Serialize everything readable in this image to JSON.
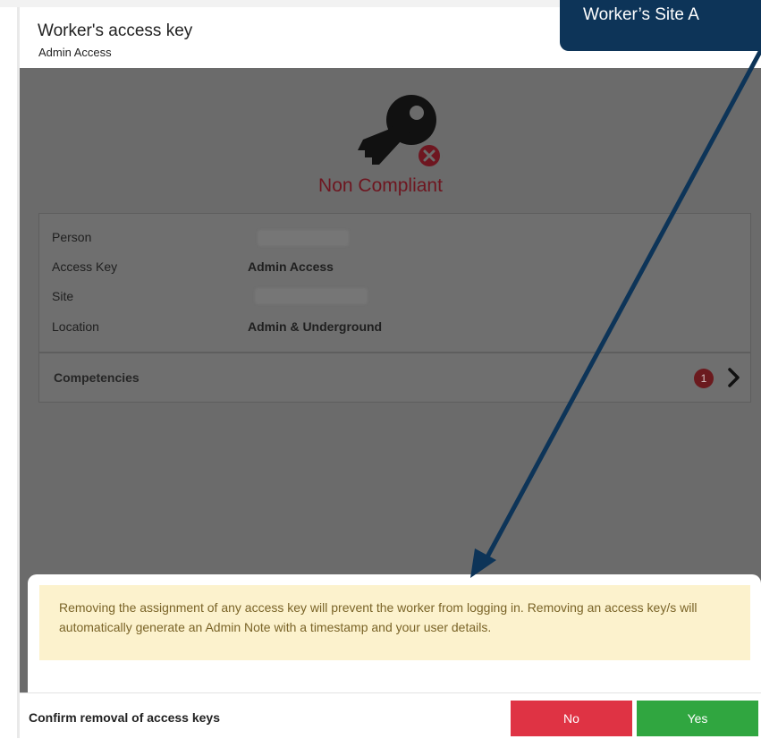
{
  "header": {
    "title": "Worker's access key",
    "subtitle": "Admin Access"
  },
  "status": {
    "text": "Non Compliant",
    "icon": "key-icon",
    "badge_icon": "x-circle-icon",
    "color": "#6e1620"
  },
  "details": {
    "rows": [
      {
        "label": "Person",
        "value": ""
      },
      {
        "label": "Access Key",
        "value": "Admin Access"
      },
      {
        "label": "Site",
        "value": ""
      },
      {
        "label": "Location",
        "value": "Admin & Underground"
      }
    ]
  },
  "competencies": {
    "label": "Competencies",
    "count": "1",
    "icon": "chevron-right-icon"
  },
  "warning": {
    "text": "Removing the assignment of any access key will prevent the worker from logging in. Removing an access key/s will automatically generate an Admin Note with a timestamp and your user details."
  },
  "footer": {
    "label": "Confirm removal of access keys",
    "no_label": "No",
    "yes_label": "Yes"
  },
  "callout": {
    "text": "Worker’s Site A"
  },
  "colors": {
    "no": "#df3344",
    "yes": "#30a640",
    "callout": "#0d3458",
    "warning_bg": "#fcf2cd"
  }
}
